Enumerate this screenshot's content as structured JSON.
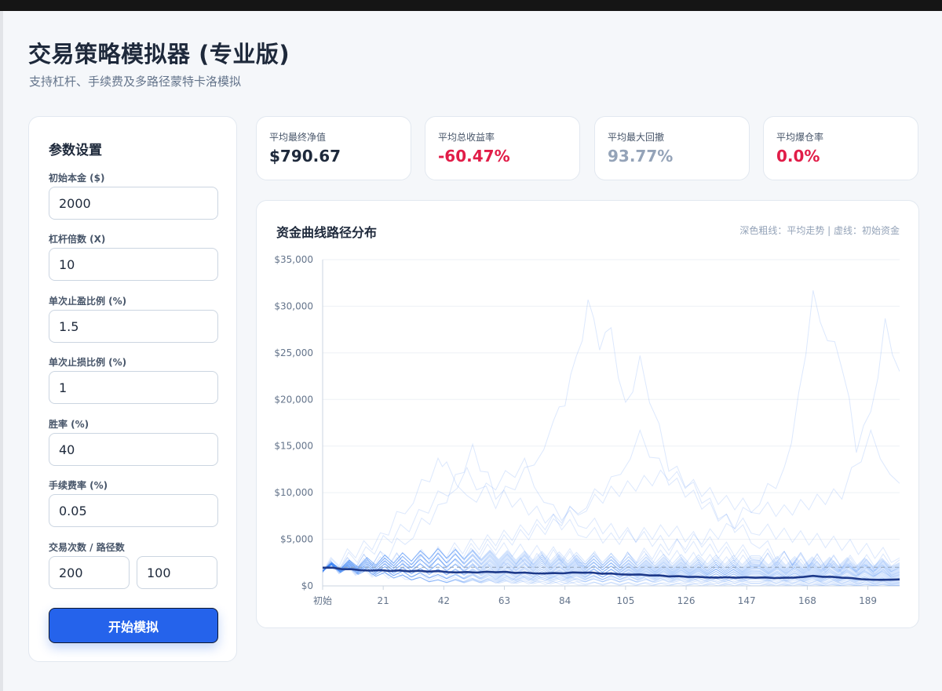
{
  "header": {
    "title": "交易策略模拟器 (专业版)",
    "subtitle": "支持杠杆、手续费及多路径蒙特卡洛模拟"
  },
  "params": {
    "title": "参数设置",
    "initial_capital": {
      "label": "初始本金 ($)",
      "value": "2000"
    },
    "leverage": {
      "label": "杠杆倍数 (X)",
      "value": "10"
    },
    "take_profit": {
      "label": "单次止盈比例 (%)",
      "value": "1.5"
    },
    "stop_loss": {
      "label": "单次止损比例 (%)",
      "value": "1"
    },
    "win_rate": {
      "label": "胜率 (%)",
      "value": "40"
    },
    "fee_rate": {
      "label": "手续费率 (%)",
      "value": "0.05"
    },
    "trades_paths": {
      "label": "交易次数 / 路径数",
      "trades": "200",
      "paths": "100"
    },
    "run_button": "开始模拟"
  },
  "stats": [
    {
      "label": "平均最终净值",
      "value": "$790.67",
      "color": "#1e293b"
    },
    {
      "label": "平均总收益率",
      "value": "-60.47%",
      "color": "#e11d48"
    },
    {
      "label": "平均最大回撤",
      "value": "93.77%",
      "color": "#94a3b8"
    },
    {
      "label": "平均爆仓率",
      "value": "0.0%",
      "color": "#e11d48"
    }
  ],
  "chart": {
    "title": "资金曲线路径分布",
    "legend": "深色粗线：平均走势 | 虚线：初始资金"
  },
  "chart_data": {
    "type": "line",
    "x_tick_labels": [
      "初始",
      "21",
      "42",
      "63",
      "84",
      "105",
      "126",
      "147",
      "168",
      "189"
    ],
    "x_ticks": [
      0,
      21,
      42,
      63,
      84,
      105,
      126,
      147,
      168,
      189
    ],
    "xlim": [
      0,
      200
    ],
    "y_tick_labels": [
      "$0",
      "$5,000",
      "$10,000",
      "$15,000",
      "$20,000",
      "$25,000",
      "$30,000",
      "$35,000"
    ],
    "y_ticks": [
      0,
      5000,
      10000,
      15000,
      20000,
      25000,
      30000,
      35000
    ],
    "ylim": [
      0,
      35000
    ],
    "initial_capital": 2000,
    "grid": true,
    "colors": {
      "paths": "#3b82f6",
      "mean": "#1e3a8a",
      "baseline": "#94a3b8"
    },
    "series": [
      {
        "role": "mean",
        "x": [
          0,
          10,
          20,
          30,
          40,
          50,
          60,
          70,
          80,
          90,
          100,
          110,
          120,
          130,
          140,
          150,
          160,
          170,
          180,
          190,
          200
        ],
        "values": [
          2000,
          1750,
          1650,
          1600,
          1550,
          1450,
          1500,
          1400,
          1350,
          1450,
          1300,
          1200,
          1050,
          950,
          900,
          900,
          850,
          1050,
          900,
          650,
          700
        ]
      },
      {
        "role": "path",
        "x": [
          0,
          15,
          30,
          40,
          50,
          60,
          70,
          80,
          84,
          88,
          92,
          96,
          100,
          105,
          110,
          120,
          140,
          160,
          180,
          200
        ],
        "values": [
          2000,
          3500,
          6500,
          9500,
          12000,
          9000,
          12000,
          17000,
          20000,
          24000,
          30000,
          26000,
          27000,
          19000,
          24000,
          13000,
          7000,
          3000,
          2000,
          1500
        ]
      },
      {
        "role": "path",
        "x": [
          0,
          20,
          40,
          60,
          80,
          100,
          120,
          140,
          160,
          165,
          170,
          175,
          180,
          185,
          190,
          195,
          200
        ],
        "values": [
          2000,
          1500,
          2500,
          1800,
          3200,
          2500,
          4000,
          6000,
          12000,
          20000,
          31000,
          27000,
          24000,
          15000,
          18000,
          28000,
          23000
        ]
      },
      {
        "role": "path",
        "x": [
          0,
          20,
          40,
          43,
          50,
          60,
          70,
          80,
          100,
          120,
          140,
          160,
          180,
          200
        ],
        "values": [
          2000,
          5000,
          13000,
          14000,
          9000,
          11000,
          13000,
          8000,
          6000,
          4500,
          3500,
          2500,
          1800,
          1200
        ]
      },
      {
        "role": "path",
        "x": [
          0,
          20,
          40,
          52,
          60,
          80,
          100,
          120,
          140,
          160,
          180,
          200
        ],
        "values": [
          2000,
          3000,
          8000,
          14500,
          10000,
          7000,
          5000,
          6000,
          4000,
          3000,
          2500,
          2000
        ]
      },
      {
        "role": "path",
        "x": [
          0,
          20,
          40,
          60,
          80,
          100,
          120,
          140,
          160,
          180,
          190,
          200
        ],
        "values": [
          2000,
          2500,
          3500,
          5000,
          7000,
          10000,
          12000,
          9000,
          8000,
          10000,
          16000,
          11000
        ]
      },
      {
        "role": "path",
        "x": [
          0,
          20,
          40,
          60,
          80,
          100,
          110,
          120,
          140,
          160,
          180,
          200
        ],
        "values": [
          2000,
          2200,
          3000,
          4500,
          6500,
          11000,
          16000,
          11500,
          7000,
          5500,
          4500,
          3000
        ]
      },
      {
        "role": "path",
        "x": [
          0,
          20,
          40,
          60,
          80,
          100,
          120,
          140,
          160,
          180,
          200
        ],
        "values": [
          2000,
          1500,
          1200,
          1000,
          800,
          700,
          600,
          500,
          450,
          400,
          350
        ]
      },
      {
        "role": "path",
        "x": [
          0,
          20,
          40,
          60,
          80,
          100,
          120,
          140,
          160,
          180,
          200
        ],
        "values": [
          2000,
          1200,
          800,
          500,
          300,
          200,
          150,
          100,
          80,
          60,
          50
        ]
      },
      {
        "role": "path",
        "x": [
          0,
          20,
          40,
          60,
          80,
          100,
          120,
          140,
          160,
          180,
          200
        ],
        "values": [
          2000,
          3000,
          2500,
          4000,
          3500,
          2800,
          3200,
          2500,
          3000,
          2600,
          2800
        ]
      }
    ]
  }
}
